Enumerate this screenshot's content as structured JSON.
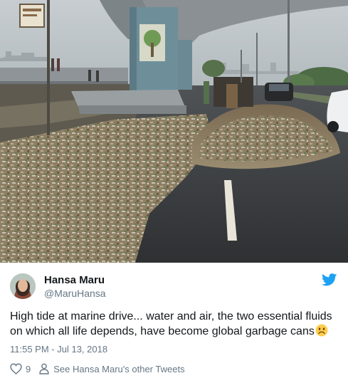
{
  "tweet": {
    "display_name": "Hansa Maru",
    "handle": "@MaruHansa",
    "text": "High tide at marine drive... water and air, the two essential fluids on which all life depends, have become global garbage cans",
    "emoji": "frowning-face",
    "timestamp": "11:55 PM - Jul 13, 2018",
    "like_count": "9",
    "other_tweets_label": "See Hansa Maru's other Tweets"
  },
  "media": {
    "description_icon": "photo",
    "scene": "garbage-on-road-under-flyover"
  },
  "icons": {
    "brand": "twitter-bird-icon",
    "like": "heart-icon",
    "profile": "person-icon"
  },
  "colors": {
    "brand": "#1da1f2",
    "text_primary": "#14171a",
    "text_secondary": "#657786",
    "emoji": "#ffcc4d"
  }
}
